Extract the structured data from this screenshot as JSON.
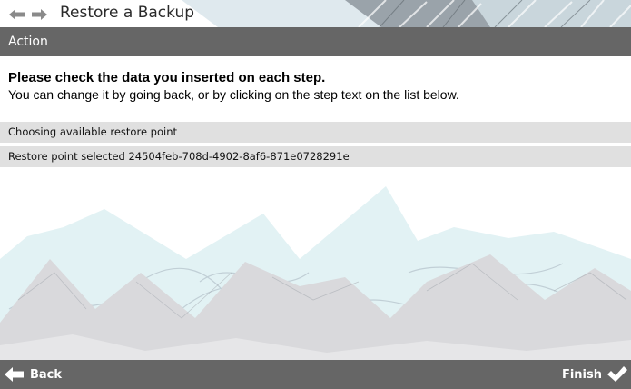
{
  "window": {
    "title": "Restore a Backup"
  },
  "nav": {
    "back_icon": "arrow-left-icon",
    "forward_icon": "arrow-right-icon"
  },
  "section": {
    "header": "Action"
  },
  "instructions": {
    "headline": "Please check the data you inserted on each step.",
    "body": "You can change it by going back, or by clicking on the step text on the list below."
  },
  "steps": [
    {
      "label": "Choosing available restore point"
    },
    {
      "label": "Restore point selected 24504feb-708d-4902-8af6-871e0728291e"
    }
  ],
  "footer": {
    "back_label": "Back",
    "finish_label": "Finish",
    "back_icon": "arrow-left-icon",
    "finish_icon": "checkmark-icon"
  },
  "colors": {
    "header_bg": "#666666",
    "step_bg": "#e0e0e0",
    "mountain_light": "#e2f2f4",
    "mountain_gray": "#d9d9dc"
  }
}
